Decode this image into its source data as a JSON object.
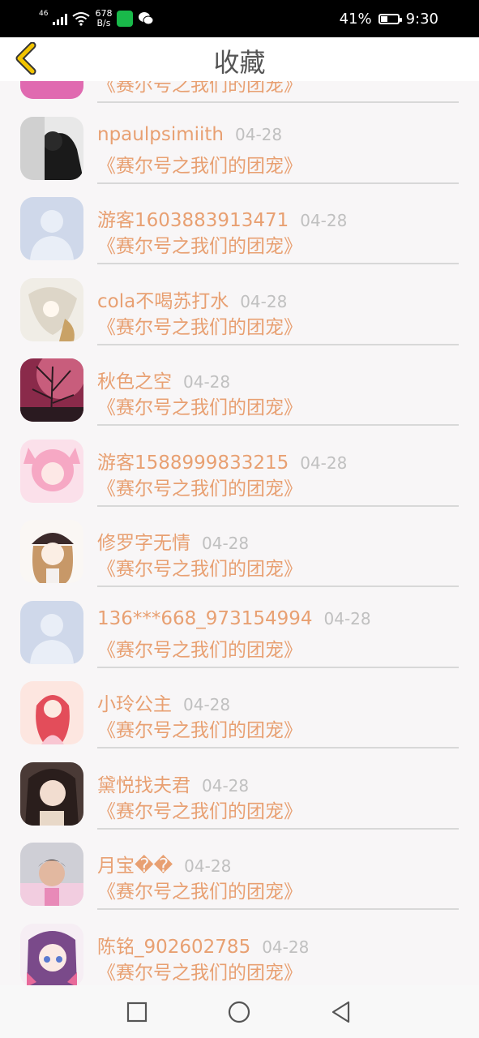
{
  "status_bar": {
    "network": "46",
    "speed_value": "678",
    "speed_unit": "B/s",
    "battery": "41%",
    "time": "9:30",
    "battery_level": 0.41,
    "app_icons": [
      "chat-app-icon",
      "wechat-icon"
    ],
    "icon_colors": {
      "chat": "#19b94a",
      "wechat": "#ffffff"
    }
  },
  "header": {
    "title": "收藏",
    "back_icon": "chevron-left-icon",
    "accent": "#f2c400"
  },
  "list": {
    "partial_top_book": "《赛尔号之我们的团宠》",
    "items": [
      {
        "name": "npaulpsimiith",
        "date": "04-28",
        "book": "《赛尔号之我们的团宠》",
        "avatar": "dark-photo"
      },
      {
        "name": "游客1603883913471",
        "date": "04-28",
        "book": "《赛尔号之我们的团宠》",
        "avatar": "default"
      },
      {
        "name": "cola不喝苏打水",
        "date": "04-28",
        "book": "《赛尔号之我们的团宠》",
        "avatar": "white-anime"
      },
      {
        "name": "秋色之空",
        "date": "04-28",
        "book": "《赛尔号之我们的团宠》",
        "avatar": "pink-sky"
      },
      {
        "name": "游客1588999833215",
        "date": "04-28",
        "book": "《赛尔号之我们的团宠》",
        "avatar": "pink-girl"
      },
      {
        "name": "修罗字无情",
        "date": "04-28",
        "book": "《赛尔号之我们的团宠》",
        "avatar": "anime-girl-hat"
      },
      {
        "name": "136***668_973154994",
        "date": "04-28",
        "book": "《赛尔号之我们的团宠》",
        "avatar": "default"
      },
      {
        "name": "小玲公主",
        "date": "04-28",
        "book": "《赛尔号之我们的团宠》",
        "avatar": "red-hair-girl"
      },
      {
        "name": "黛悦找夫君",
        "date": "04-28",
        "book": "《赛尔号之我们的团宠》",
        "avatar": "dark-hair-girl"
      },
      {
        "name": "月宝��",
        "date": "04-28",
        "book": "《赛尔号之我们的团宠》",
        "avatar": "photo-girl"
      },
      {
        "name": "陈铭_902602785",
        "date": "04-28",
        "book": "《赛尔号之我们的团宠》",
        "avatar": "purple-hair-girl"
      }
    ]
  },
  "colors": {
    "name_text": "#e8a072",
    "date_text": "#c0c0c0",
    "title_text": "#555555"
  },
  "nav": {
    "icons": [
      "recent-apps-icon",
      "home-icon",
      "back-triangle-icon"
    ]
  }
}
